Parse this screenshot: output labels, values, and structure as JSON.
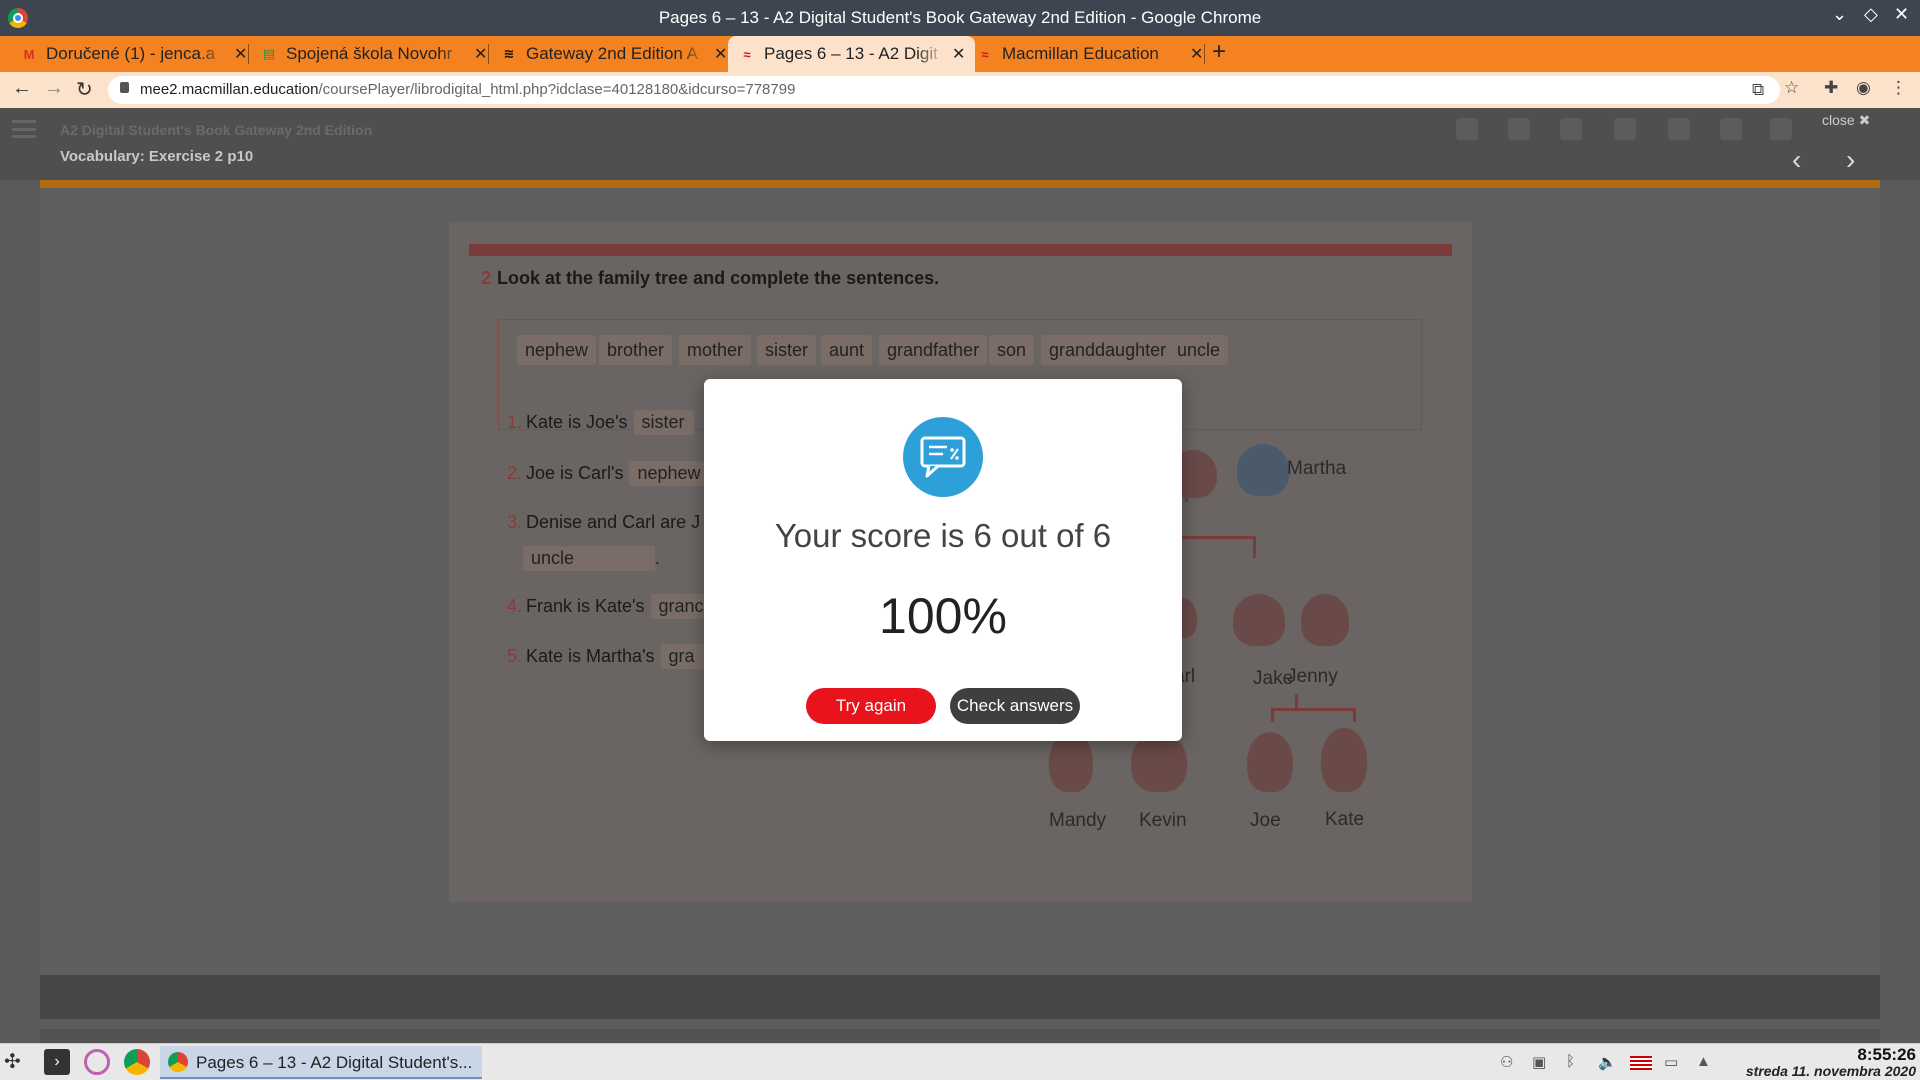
{
  "window": {
    "title": "Pages 6 – 13 - A2 Digital Student's Book Gateway 2nd Edition - Google Chrome"
  },
  "tabs": [
    {
      "label": "Doručené (1) - jenca.a",
      "favicon": "gmail-icon"
    },
    {
      "label": "Spojená škola Novohr",
      "favicon": "sheets-icon"
    },
    {
      "label": "Gateway 2nd Edition A",
      "favicon": "gateway-icon"
    },
    {
      "label": "Pages 6 – 13 - A2 Digit",
      "favicon": "macmillan-icon",
      "active": true
    },
    {
      "label": "Macmillan Education",
      "favicon": "macmillan-icon"
    }
  ],
  "address": {
    "host": "mee2.macmillan.education",
    "path": "/coursePlayer/librodigital_html.php?idclase=40128180&idcurso=778799"
  },
  "app": {
    "book_title": "A2 Digital Student's Book Gateway 2nd Edition",
    "exercise_title": "Vocabulary: Exercise 2 p10",
    "close_label": "close ✖"
  },
  "exercise": {
    "number": "2",
    "instruction": "Look at the family tree and complete the sentences.",
    "words": [
      "nephew",
      "brother",
      "mother",
      "sister",
      "aunt",
      "grandfather",
      "son",
      "granddaughter",
      "uncle"
    ],
    "sentences": [
      {
        "n": "1.",
        "text": "Kate is Joe's",
        "answer": "sister"
      },
      {
        "n": "2.",
        "text": "Joe is Carl's",
        "answer": "nephew"
      },
      {
        "n": "3.",
        "text": "Denise and Carl are J",
        "answer": "uncle",
        "suffix": "."
      },
      {
        "n": "4.",
        "text": "Frank is Kate's",
        "answer": "granc"
      },
      {
        "n": "5.",
        "text": "Kate is Martha's",
        "answer": "gra"
      }
    ],
    "tree_names": [
      "Martha",
      "arl",
      "Jake",
      "Jenny",
      "Mandy",
      "Kevin",
      "Joe",
      "Kate"
    ]
  },
  "modal": {
    "score_text": "Your score is 6 out of 6",
    "percent": "100%",
    "try_again": "Try again",
    "check_answers": "Check answers"
  },
  "taskbar": {
    "task_label": "Pages 6 – 13 - A2 Digital Student's...",
    "time": "8:55:26",
    "date": "streda 11. novembra 2020"
  },
  "colors": {
    "tab_bar": "#f58220",
    "try_again": "#e8131b",
    "modal_icon": "#2d9fd9"
  }
}
